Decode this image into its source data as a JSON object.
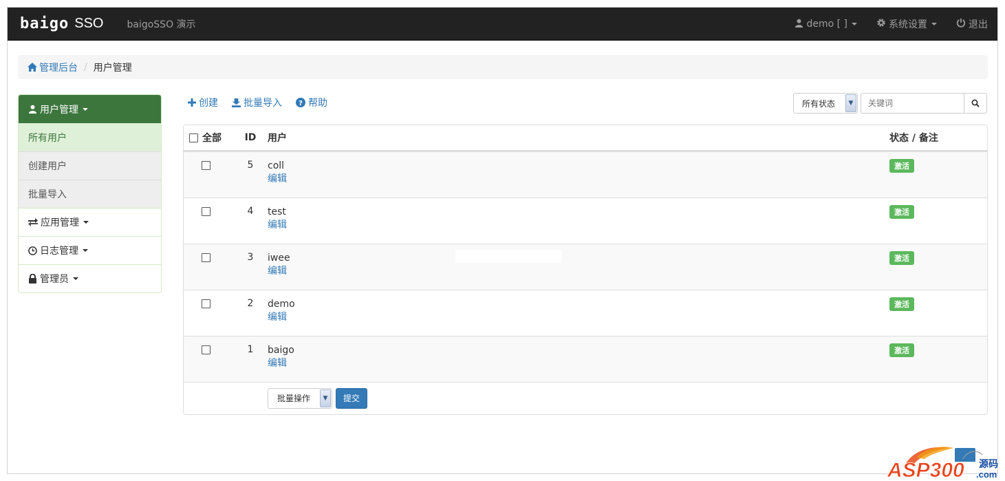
{
  "navbar": {
    "logo": "baigo",
    "logo_suffix": "SSO",
    "demo_text": "baigoSSO 演示",
    "user": "demo [ ]",
    "settings": "系统设置",
    "logout": "退出"
  },
  "breadcrumb": {
    "home": "管理后台",
    "current": "用户管理"
  },
  "sidebar": {
    "header": "用户管理",
    "items": [
      "所有用户",
      "创建用户",
      "批量导入"
    ],
    "groups": [
      "应用管理",
      "日志管理",
      "管理员"
    ]
  },
  "toolbar": {
    "create": "创建",
    "import": "批量导入",
    "help": "帮助"
  },
  "filters": {
    "status": "所有状态",
    "keyword_placeholder": "关键词"
  },
  "table": {
    "headers": {
      "select_all": "全部",
      "id": "ID",
      "user": "用户",
      "status": "状态 / 备注"
    },
    "edit_label": "编辑",
    "rows": [
      {
        "id": "5",
        "user": "coll",
        "status": "激活"
      },
      {
        "id": "4",
        "user": "test",
        "status": "激活"
      },
      {
        "id": "3",
        "user": "iwee",
        "status": "激活"
      },
      {
        "id": "2",
        "user": "demo",
        "status": "激活"
      },
      {
        "id": "1",
        "user": "baigo",
        "status": "激活"
      }
    ],
    "batch_action": "批量操作",
    "submit": "提交"
  },
  "watermark": {
    "main": "ASP300",
    "sub1": "源码",
    "sub2": ".com"
  },
  "colors": {
    "navbar": "#222222",
    "primary": "#337ab7",
    "success": "#5cb85c",
    "sidebar_header": "#3c763d",
    "sidebar_active": "#dff0d8"
  }
}
